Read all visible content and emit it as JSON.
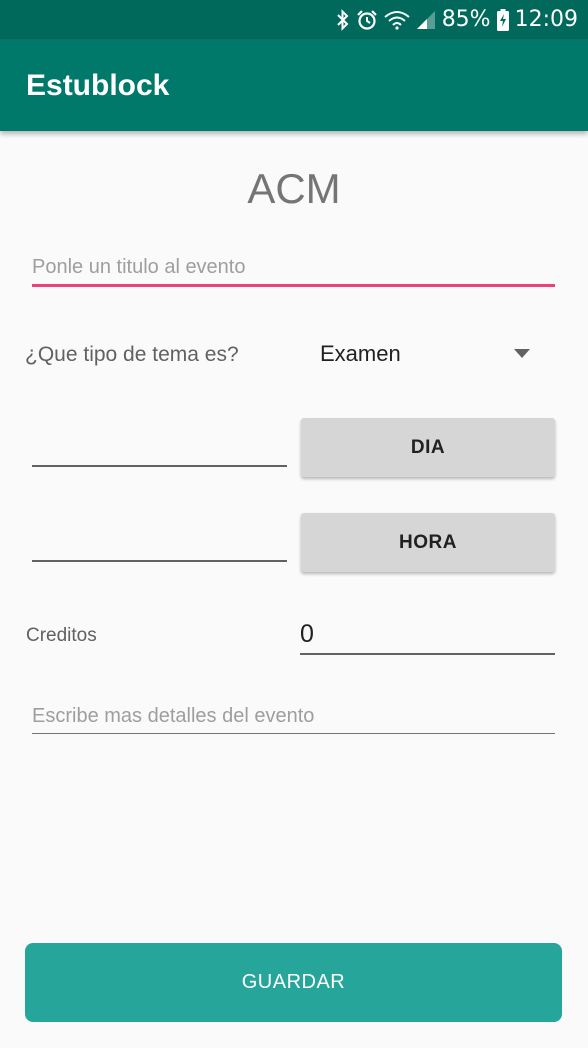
{
  "status_bar": {
    "battery_percent": "85%",
    "time": "12:09",
    "icons": [
      "bluetooth-icon",
      "alarm-icon",
      "wifi-icon",
      "signal-icon",
      "battery-icon"
    ]
  },
  "app_bar": {
    "title": "Estublock"
  },
  "form": {
    "title": "ACM",
    "event_title_placeholder": "Ponle un titulo al evento",
    "type_label": "¿Que tipo de tema es?",
    "type_value": "Examen",
    "day_button": "DIA",
    "hour_button": "HORA",
    "credits_label": "Creditos",
    "credits_value": "0",
    "details_placeholder": "Escribe mas detalles del evento",
    "save_button": "GUARDAR"
  },
  "colors": {
    "status_bar": "#00695c",
    "app_bar": "#00796b",
    "accent": "#ec407a",
    "save_button": "#26a69a",
    "button_grey": "#d6d6d6"
  }
}
